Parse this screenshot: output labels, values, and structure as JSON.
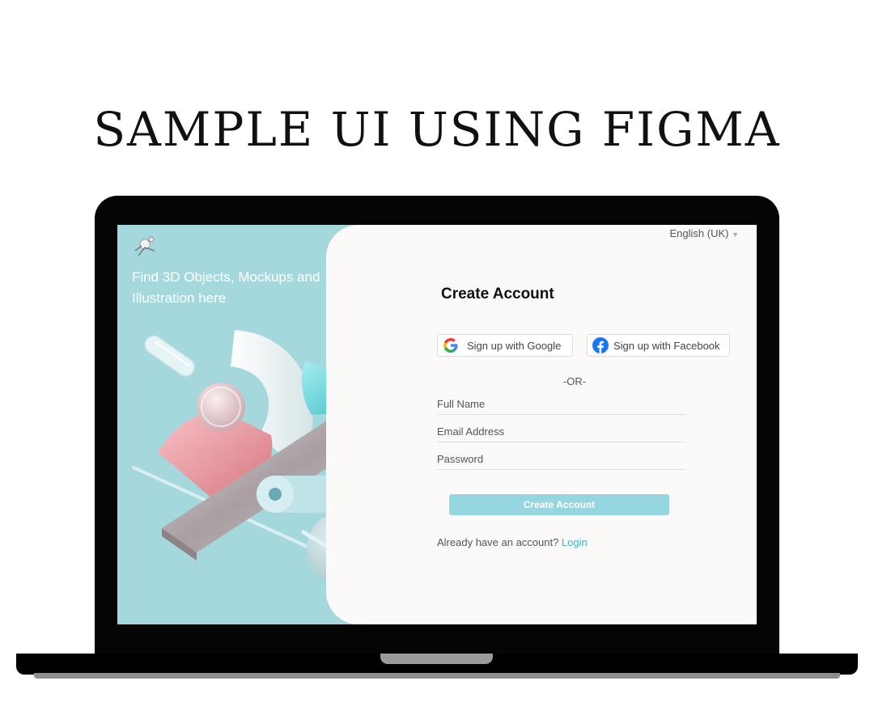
{
  "heading": "SAMPLE UI USING FIGMA",
  "left_panel": {
    "tagline": "Find 3D Objects, Mockups and Illustration here"
  },
  "language": {
    "selected": "English (UK)"
  },
  "form": {
    "title": "Create Account",
    "google_label": "Sign up with Google",
    "facebook_label": "Sign up with Facebook",
    "or_label": "-OR-",
    "full_name_label": "Full Name",
    "email_label": "Email Address",
    "password_label": "Password",
    "submit_label": "Create Account",
    "login_prompt": "Already have an account?",
    "login_link": "Login"
  },
  "colors": {
    "panel": "#a4d8dd",
    "button": "#96d6de",
    "link": "#3bb5cc",
    "facebook": "#1877f2"
  },
  "icons": [
    "google-icon",
    "facebook-icon",
    "caret-down-icon",
    "logo-icon"
  ]
}
